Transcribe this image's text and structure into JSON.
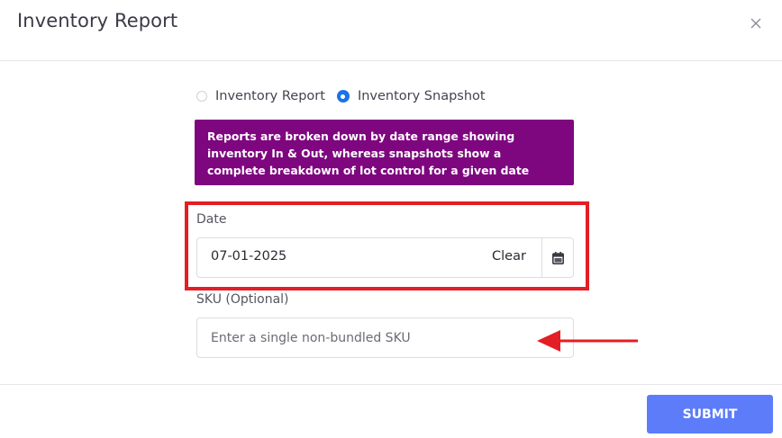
{
  "modal": {
    "title": "Inventory Report"
  },
  "report_type": {
    "options": [
      {
        "label": "Inventory Report",
        "selected": false
      },
      {
        "label": "Inventory Snapshot",
        "selected": true
      }
    ]
  },
  "info_box": {
    "text": "Reports are broken down by date range showing inventory In & Out, whereas snapshots show a complete breakdown of lot control for a given date",
    "background": "#7e067f"
  },
  "date_field": {
    "label": "Date",
    "value": "07-01-2025",
    "clear_label": "Clear",
    "icon": "calendar-icon"
  },
  "sku_field": {
    "label": "SKU (Optional)",
    "placeholder": "Enter a single non-bundled SKU",
    "value": ""
  },
  "footer": {
    "submit_label": "SUBMIT",
    "submit_color": "#5c7cfa"
  },
  "annotation": {
    "highlight_color": "#e31e24",
    "arrow_color": "#e31e24"
  },
  "icons": {
    "close": "close-icon",
    "calendar": "calendar-icon"
  }
}
